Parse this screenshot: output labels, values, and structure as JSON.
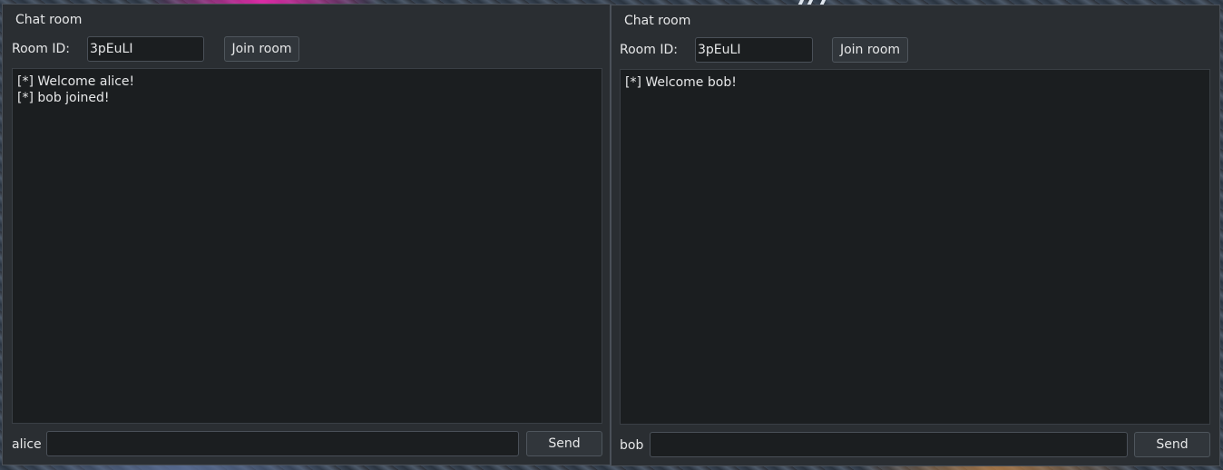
{
  "windows": [
    {
      "title": "Chat room",
      "room_label": "Room ID:",
      "room_id": "3pEuLI",
      "join_label": "Join room",
      "log": [
        "[*] Welcome alice!",
        "[*] bob joined!"
      ],
      "user": "alice",
      "message_value": "",
      "send_label": "Send"
    },
    {
      "title": "Chat room",
      "room_label": "Room ID:",
      "room_id": "3pEuLI",
      "join_label": "Join room",
      "log": [
        "[*] Welcome bob!"
      ],
      "user": "bob",
      "message_value": "",
      "send_label": "Send"
    }
  ]
}
